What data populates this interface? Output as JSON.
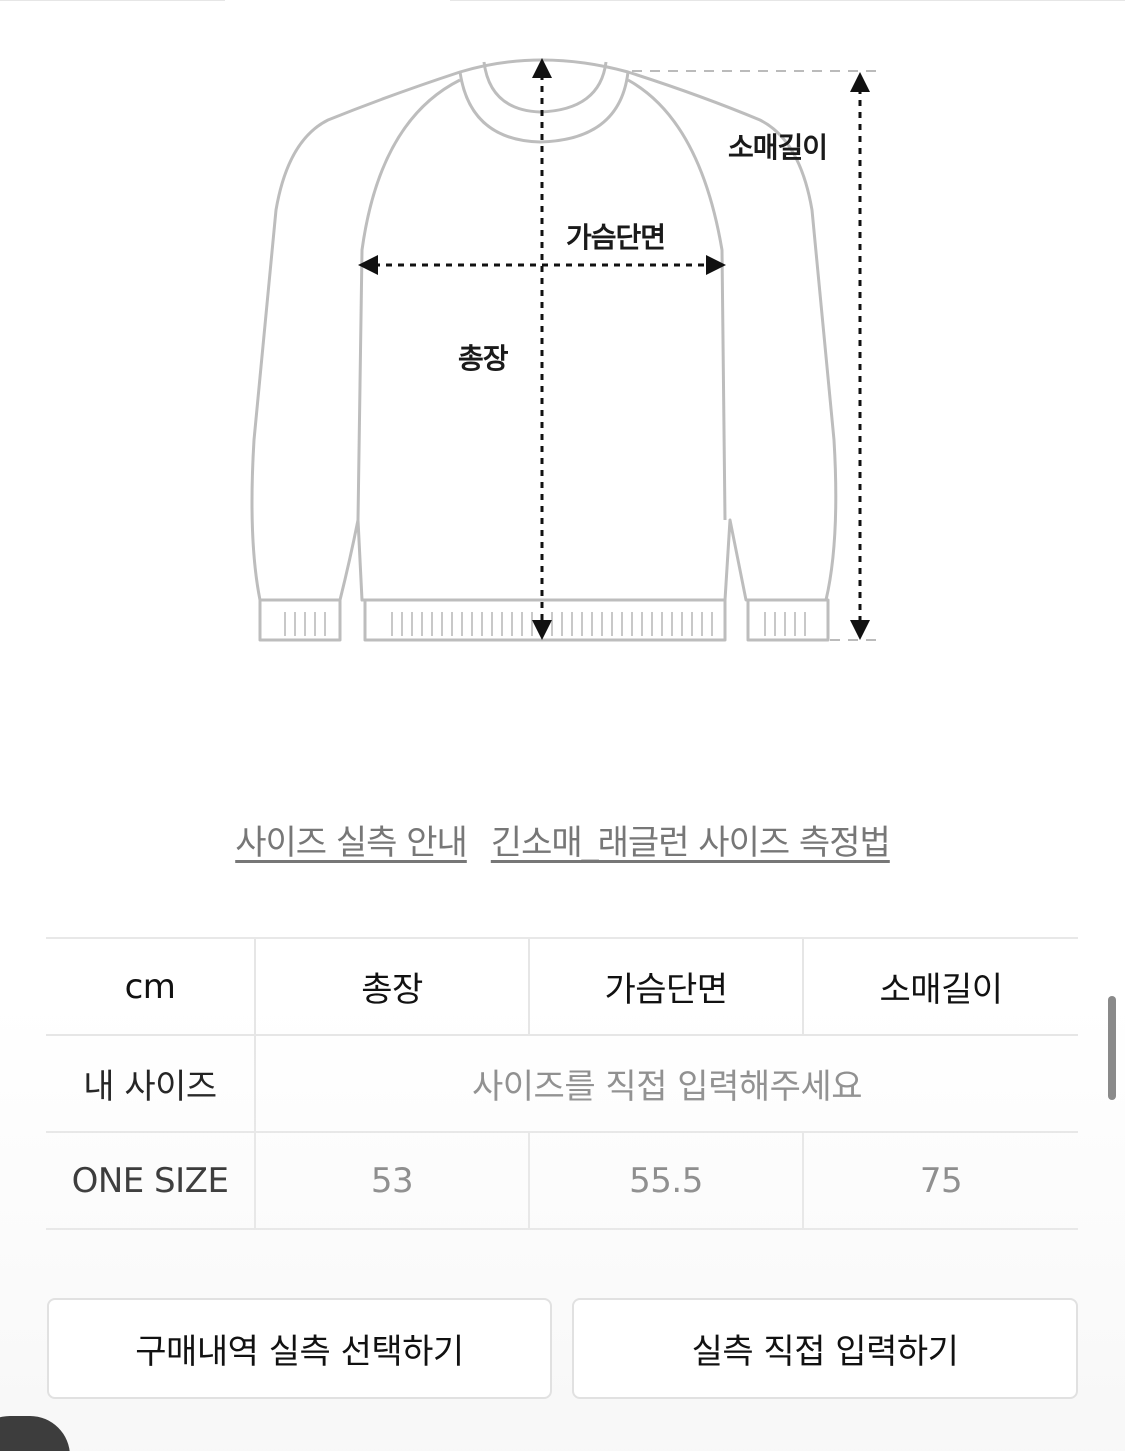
{
  "diagram": {
    "labels": {
      "sleeve_length": "소매길이",
      "chest_width": "가슴단면",
      "total_length": "총장"
    }
  },
  "guide_links": {
    "size_guide": "사이즈 실측 안내",
    "measure_method": "긴소매_래글런 사이즈 측정법"
  },
  "size_table": {
    "headers": [
      "cm",
      "총장",
      "가슴단면",
      "소매길이"
    ],
    "my_size_label": "내 사이즈",
    "my_size_placeholder": "사이즈를 직접 입력해주세요",
    "rows": [
      {
        "size": "ONE SIZE",
        "values": [
          "53",
          "55.5",
          "75"
        ]
      }
    ]
  },
  "buttons": {
    "select_from_orders": "구매내역 실측 선택하기",
    "enter_directly": "실측 직접 입력하기"
  }
}
